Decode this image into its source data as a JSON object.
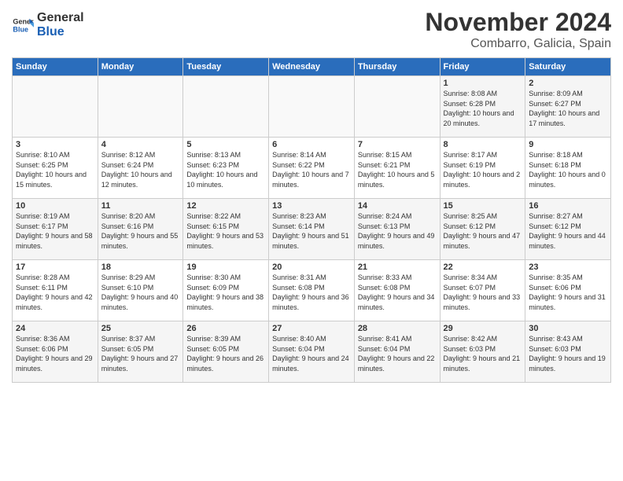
{
  "header": {
    "logo_line1": "General",
    "logo_line2": "Blue",
    "month_title": "November 2024",
    "location": "Combarro, Galicia, Spain"
  },
  "weekdays": [
    "Sunday",
    "Monday",
    "Tuesday",
    "Wednesday",
    "Thursday",
    "Friday",
    "Saturday"
  ],
  "weeks": [
    [
      {
        "day": "",
        "info": ""
      },
      {
        "day": "",
        "info": ""
      },
      {
        "day": "",
        "info": ""
      },
      {
        "day": "",
        "info": ""
      },
      {
        "day": "",
        "info": ""
      },
      {
        "day": "1",
        "info": "Sunrise: 8:08 AM\nSunset: 6:28 PM\nDaylight: 10 hours and 20 minutes."
      },
      {
        "day": "2",
        "info": "Sunrise: 8:09 AM\nSunset: 6:27 PM\nDaylight: 10 hours and 17 minutes."
      }
    ],
    [
      {
        "day": "3",
        "info": "Sunrise: 8:10 AM\nSunset: 6:25 PM\nDaylight: 10 hours and 15 minutes."
      },
      {
        "day": "4",
        "info": "Sunrise: 8:12 AM\nSunset: 6:24 PM\nDaylight: 10 hours and 12 minutes."
      },
      {
        "day": "5",
        "info": "Sunrise: 8:13 AM\nSunset: 6:23 PM\nDaylight: 10 hours and 10 minutes."
      },
      {
        "day": "6",
        "info": "Sunrise: 8:14 AM\nSunset: 6:22 PM\nDaylight: 10 hours and 7 minutes."
      },
      {
        "day": "7",
        "info": "Sunrise: 8:15 AM\nSunset: 6:21 PM\nDaylight: 10 hours and 5 minutes."
      },
      {
        "day": "8",
        "info": "Sunrise: 8:17 AM\nSunset: 6:19 PM\nDaylight: 10 hours and 2 minutes."
      },
      {
        "day": "9",
        "info": "Sunrise: 8:18 AM\nSunset: 6:18 PM\nDaylight: 10 hours and 0 minutes."
      }
    ],
    [
      {
        "day": "10",
        "info": "Sunrise: 8:19 AM\nSunset: 6:17 PM\nDaylight: 9 hours and 58 minutes."
      },
      {
        "day": "11",
        "info": "Sunrise: 8:20 AM\nSunset: 6:16 PM\nDaylight: 9 hours and 55 minutes."
      },
      {
        "day": "12",
        "info": "Sunrise: 8:22 AM\nSunset: 6:15 PM\nDaylight: 9 hours and 53 minutes."
      },
      {
        "day": "13",
        "info": "Sunrise: 8:23 AM\nSunset: 6:14 PM\nDaylight: 9 hours and 51 minutes."
      },
      {
        "day": "14",
        "info": "Sunrise: 8:24 AM\nSunset: 6:13 PM\nDaylight: 9 hours and 49 minutes."
      },
      {
        "day": "15",
        "info": "Sunrise: 8:25 AM\nSunset: 6:12 PM\nDaylight: 9 hours and 47 minutes."
      },
      {
        "day": "16",
        "info": "Sunrise: 8:27 AM\nSunset: 6:12 PM\nDaylight: 9 hours and 44 minutes."
      }
    ],
    [
      {
        "day": "17",
        "info": "Sunrise: 8:28 AM\nSunset: 6:11 PM\nDaylight: 9 hours and 42 minutes."
      },
      {
        "day": "18",
        "info": "Sunrise: 8:29 AM\nSunset: 6:10 PM\nDaylight: 9 hours and 40 minutes."
      },
      {
        "day": "19",
        "info": "Sunrise: 8:30 AM\nSunset: 6:09 PM\nDaylight: 9 hours and 38 minutes."
      },
      {
        "day": "20",
        "info": "Sunrise: 8:31 AM\nSunset: 6:08 PM\nDaylight: 9 hours and 36 minutes."
      },
      {
        "day": "21",
        "info": "Sunrise: 8:33 AM\nSunset: 6:08 PM\nDaylight: 9 hours and 34 minutes."
      },
      {
        "day": "22",
        "info": "Sunrise: 8:34 AM\nSunset: 6:07 PM\nDaylight: 9 hours and 33 minutes."
      },
      {
        "day": "23",
        "info": "Sunrise: 8:35 AM\nSunset: 6:06 PM\nDaylight: 9 hours and 31 minutes."
      }
    ],
    [
      {
        "day": "24",
        "info": "Sunrise: 8:36 AM\nSunset: 6:06 PM\nDaylight: 9 hours and 29 minutes."
      },
      {
        "day": "25",
        "info": "Sunrise: 8:37 AM\nSunset: 6:05 PM\nDaylight: 9 hours and 27 minutes."
      },
      {
        "day": "26",
        "info": "Sunrise: 8:39 AM\nSunset: 6:05 PM\nDaylight: 9 hours and 26 minutes."
      },
      {
        "day": "27",
        "info": "Sunrise: 8:40 AM\nSunset: 6:04 PM\nDaylight: 9 hours and 24 minutes."
      },
      {
        "day": "28",
        "info": "Sunrise: 8:41 AM\nSunset: 6:04 PM\nDaylight: 9 hours and 22 minutes."
      },
      {
        "day": "29",
        "info": "Sunrise: 8:42 AM\nSunset: 6:03 PM\nDaylight: 9 hours and 21 minutes."
      },
      {
        "day": "30",
        "info": "Sunrise: 8:43 AM\nSunset: 6:03 PM\nDaylight: 9 hours and 19 minutes."
      }
    ]
  ]
}
